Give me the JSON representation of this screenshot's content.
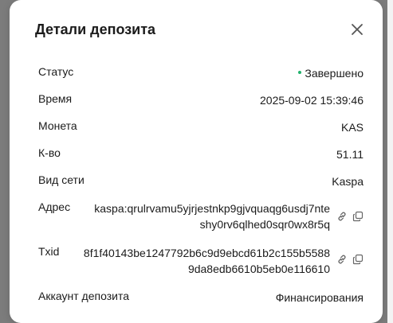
{
  "modal": {
    "title": "Детали депозита"
  },
  "rows": {
    "status": {
      "label": "Статус",
      "value": "Завершено",
      "status_color": "#20b26c"
    },
    "time": {
      "label": "Время",
      "value": "2025-09-02 15:39:46"
    },
    "coin": {
      "label": "Монета",
      "value": "KAS"
    },
    "amount": {
      "label": "К-во",
      "value": "51.11"
    },
    "network": {
      "label": "Вид сети",
      "value": "Kaspa"
    },
    "address": {
      "label": "Адрес",
      "value_line1": "kaspa:qrulrvamu5yjrjestnkp9gjvquaqg6usdj7nte",
      "value_line2": "shy0rv6qlhed0sqr0wx8r5q"
    },
    "txid": {
      "label": "Txid",
      "value_line1": "8f1f40143be1247792b6c9d9ebcd61b2c155b5588",
      "value_line2": "9da8edb6610b5eb0e116610"
    },
    "account": {
      "label": "Аккаунт депозита",
      "value": "Финансирования"
    }
  },
  "icons": {
    "close": "close-icon",
    "link": "link-icon",
    "copy": "copy-icon"
  }
}
